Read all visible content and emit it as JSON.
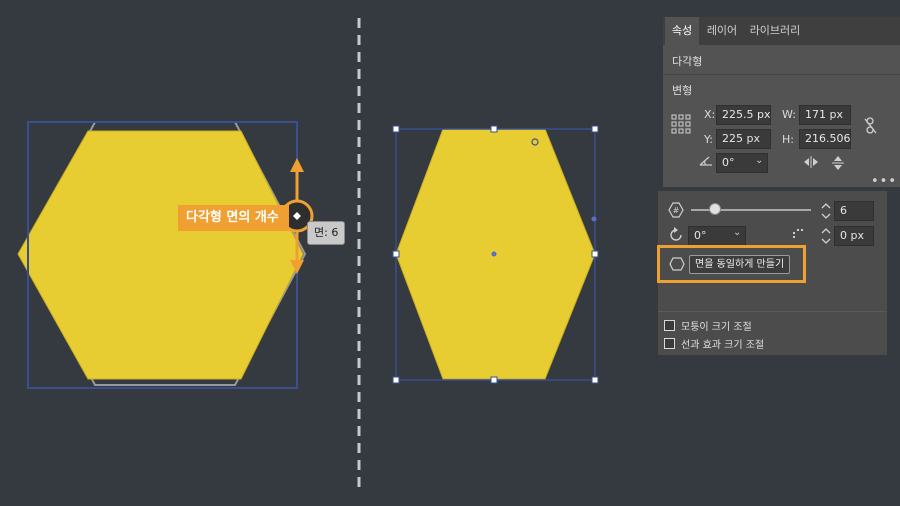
{
  "canvas": {
    "callout_label": "다각형 면의 개수",
    "tooltip_label": "면: 6"
  },
  "panel": {
    "tabs": [
      "속성",
      "레이어",
      "라이브러리"
    ],
    "active_tab": "속성",
    "object_type": "다각형",
    "transform_section": "변형",
    "x_label": "X:",
    "x_value": "225.5 px",
    "y_label": "Y:",
    "y_value": "225 px",
    "w_label": "W:",
    "w_value": "171 px",
    "h_label": "H:",
    "h_value": "216.506 p",
    "rotate_value": "0°",
    "more_icon": "ellipsis-icon"
  },
  "polygon_popup": {
    "sides_value": "6",
    "sides_slider_fraction": 0.25,
    "rotation_value": "0°",
    "corner_radius_value": "0 px",
    "make_equal_label": "면을 동일하게 만들기",
    "scale_corners_label": "모퉁이 크기 조절",
    "scale_strokes_label": "선과 효과 크기 조절"
  },
  "colors": {
    "canvas_bg": "#353a41",
    "hexagon_fill": "#e8cd32",
    "selection_blue": "#3a4f8f",
    "highlight_orange": "#f0a030"
  }
}
